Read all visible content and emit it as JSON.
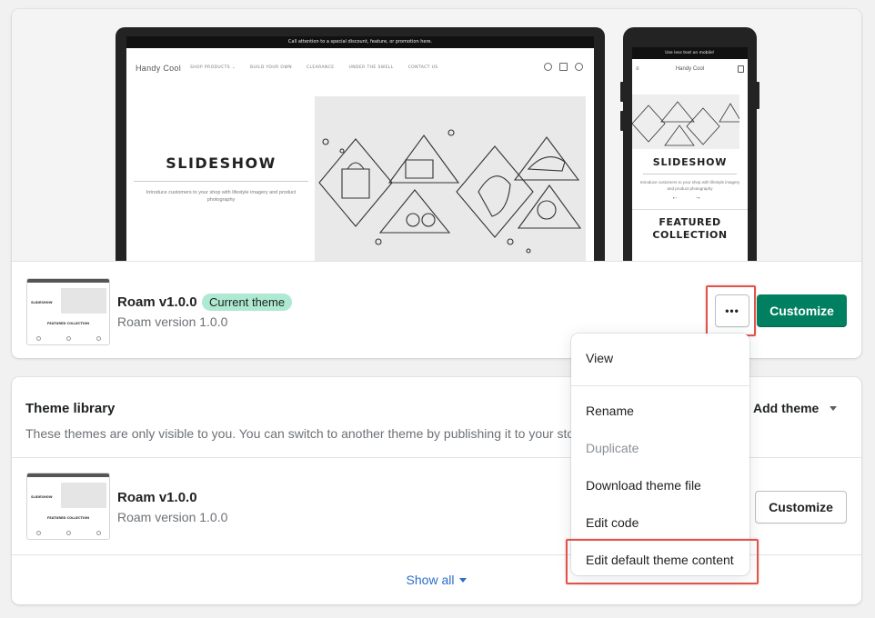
{
  "current_theme": {
    "preview": {
      "announcement": "Call attention to a special discount, feature, or promotion here.",
      "store_name": "Handy Cool",
      "nav": [
        "SHOP PRODUCTS ⌄",
        "BUILD YOUR OWN",
        "CLEARANCE",
        "UNDER THE SWELL",
        "CONTACT US"
      ],
      "slideshow_title": "SLIDESHOW",
      "slideshow_text": "Introduce customers to your shop with lifestyle imagery and product photography",
      "mobile_announcement": "Use less text on mobile!",
      "mobile_featured": "FEATURED COLLECTION",
      "mobile_arrows": "← →"
    },
    "thumb": {
      "title": "SLIDESHOW",
      "featured": "FEATURED COLLECTION"
    },
    "name": "Roam v1.0.0",
    "badge": "Current theme",
    "version": "Roam version 1.0.0",
    "more_label": "•••",
    "customize_label": "Customize"
  },
  "library": {
    "title": "Theme library",
    "description": "These themes are only visible to you. You can switch to another theme by publishing it to your sto",
    "add_theme_label": "Add theme",
    "themes": [
      {
        "name": "Roam v1.0.0",
        "version": "Roam version 1.0.0",
        "customize_label": "Customize",
        "thumb": {
          "title": "SLIDESHOW",
          "featured": "FEATURED COLLECTION"
        }
      }
    ],
    "show_all": "Show all"
  },
  "actions_menu": {
    "items": [
      {
        "label": "View"
      },
      {
        "label": "Rename"
      },
      {
        "label": "Duplicate",
        "disabled": true
      },
      {
        "label": "Download theme file"
      },
      {
        "label": "Edit code"
      },
      {
        "label": "Edit default theme content"
      }
    ]
  },
  "colors": {
    "primary": "#008060",
    "badge_bg": "#aee9d1",
    "highlight": "#e0554b",
    "link": "#2c6ecb"
  }
}
